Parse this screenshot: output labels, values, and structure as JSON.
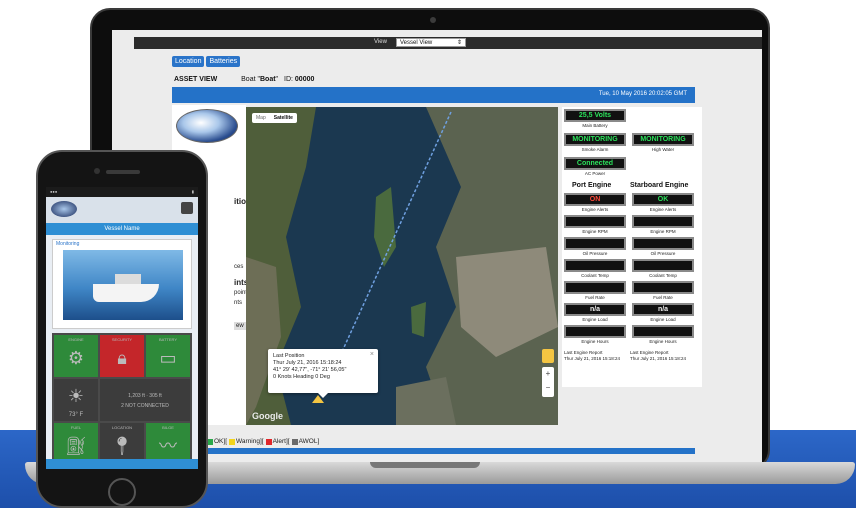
{
  "top_bar": {
    "view_label": "View",
    "view_select": "Vessel View"
  },
  "tabs": [
    "Location",
    "Batteries"
  ],
  "asset": {
    "title": "ASSET VIEW",
    "boat_label": "Boat \"",
    "boat_name": "Boat",
    "boat_suffix": "\"",
    "id_label": "ID:",
    "id_value": "00000"
  },
  "header": {
    "datetime": "Tue, 10 May 2016 20:02:05 GMT"
  },
  "left_fragments": [
    "ition",
    "ces",
    "ints",
    "points",
    "nts",
    "ew"
  ],
  "map": {
    "tabs": [
      "Map",
      "Satellite"
    ],
    "google": "Google",
    "popup": {
      "title": "Last Position",
      "time": "Thur July 21, 2016 15:18:24",
      "coords": "41° 29' 42,77\", -71° 21' 56,05\"",
      "speed": "0 Knots Heading 0 Deg"
    }
  },
  "top_gauges": [
    {
      "value": "25,5 Volts",
      "caption": "Main Battery",
      "color": "#2be05b"
    },
    {
      "value": "MONITORING",
      "caption": "Smoke Alarm",
      "color": "#2be05b"
    },
    {
      "value": "MONITORING",
      "caption": "High Water",
      "color": "#2be05b"
    },
    {
      "value": "Connected",
      "caption": "AC Power",
      "color": "#2be05b"
    }
  ],
  "engines": {
    "port_title": "Port Engine",
    "starboard_title": "Starboard Engine",
    "port": [
      {
        "value": "ON",
        "caption": "Engine Alerts",
        "color": "#ff4a3a"
      },
      {
        "value": "",
        "caption": "Engine RPM",
        "color": "#f2f2f2"
      },
      {
        "value": "",
        "caption": "Oil Pressure",
        "color": "#f2f2f2"
      },
      {
        "value": "",
        "caption": "Coolant Temp",
        "color": "#f2f2f2"
      },
      {
        "value": "",
        "caption": "Fuel Rate",
        "color": "#f2f2f2"
      },
      {
        "value": "n/a",
        "caption": "Engine Load",
        "color": "#f2f2f2"
      },
      {
        "value": "",
        "caption": "Engine Hours",
        "color": "#f2f2f2"
      }
    ],
    "starboard": [
      {
        "value": "OK",
        "caption": "Engine Alerts",
        "color": "#2be05b"
      },
      {
        "value": "",
        "caption": "Engine RPM",
        "color": "#f2f2f2"
      },
      {
        "value": "",
        "caption": "Oil Pressure",
        "color": "#f2f2f2"
      },
      {
        "value": "",
        "caption": "Coolant Temp",
        "color": "#f2f2f2"
      },
      {
        "value": "",
        "caption": "Fuel Rate",
        "color": "#f2f2f2"
      },
      {
        "value": "n/a",
        "caption": "Engine Load",
        "color": "#f2f2f2"
      },
      {
        "value": "",
        "caption": "Engine Hours",
        "color": "#f2f2f2"
      }
    ],
    "port_last_label": "Last Engine Report",
    "port_last_time": "Thur July 21, 2016 15:18:24",
    "starboard_last_label": "Last Engine Report",
    "starboard_last_time": "Thur July 21, 2016 15:18:24"
  },
  "legend": {
    "ok": "OK][",
    "warning": "Warning][",
    "alert": "Alert][",
    "awol": "AWOL]",
    "colors": {
      "ok": "#2aa84a",
      "warning": "#f2d41c",
      "alert": "#e0262a",
      "awol": "#6a6a6a"
    }
  },
  "phone": {
    "vessel_name": "Vessel Name",
    "monitoring_label": "Monitoring",
    "tiles": [
      {
        "label": "ENGINE",
        "icon": "engine-icon",
        "color": "#2e8a3a"
      },
      {
        "label": "SECURITY",
        "icon": "lock-icon",
        "color": "#c4262a"
      },
      {
        "label": "BATTERY",
        "icon": "battery-icon",
        "color": "#2e8a3a"
      },
      {
        "label": "",
        "icon": "weather-icon",
        "color": "#3c3c3c",
        "value": "73° F"
      },
      {
        "label": "",
        "icon": "info-icon",
        "color": "#3c3c3c",
        "value": "1,203 ft · 305 ft",
        "sub": "2 NOT CONNECTED"
      },
      {
        "label": "FUEL",
        "icon": "fuel-icon",
        "color": "#2e8a3a"
      },
      {
        "label": "LOCATION",
        "icon": "map-pin-icon",
        "color": "#3c3c3c"
      },
      {
        "label": "BILGE",
        "icon": "wave-icon",
        "color": "#2e8a3a"
      }
    ]
  }
}
